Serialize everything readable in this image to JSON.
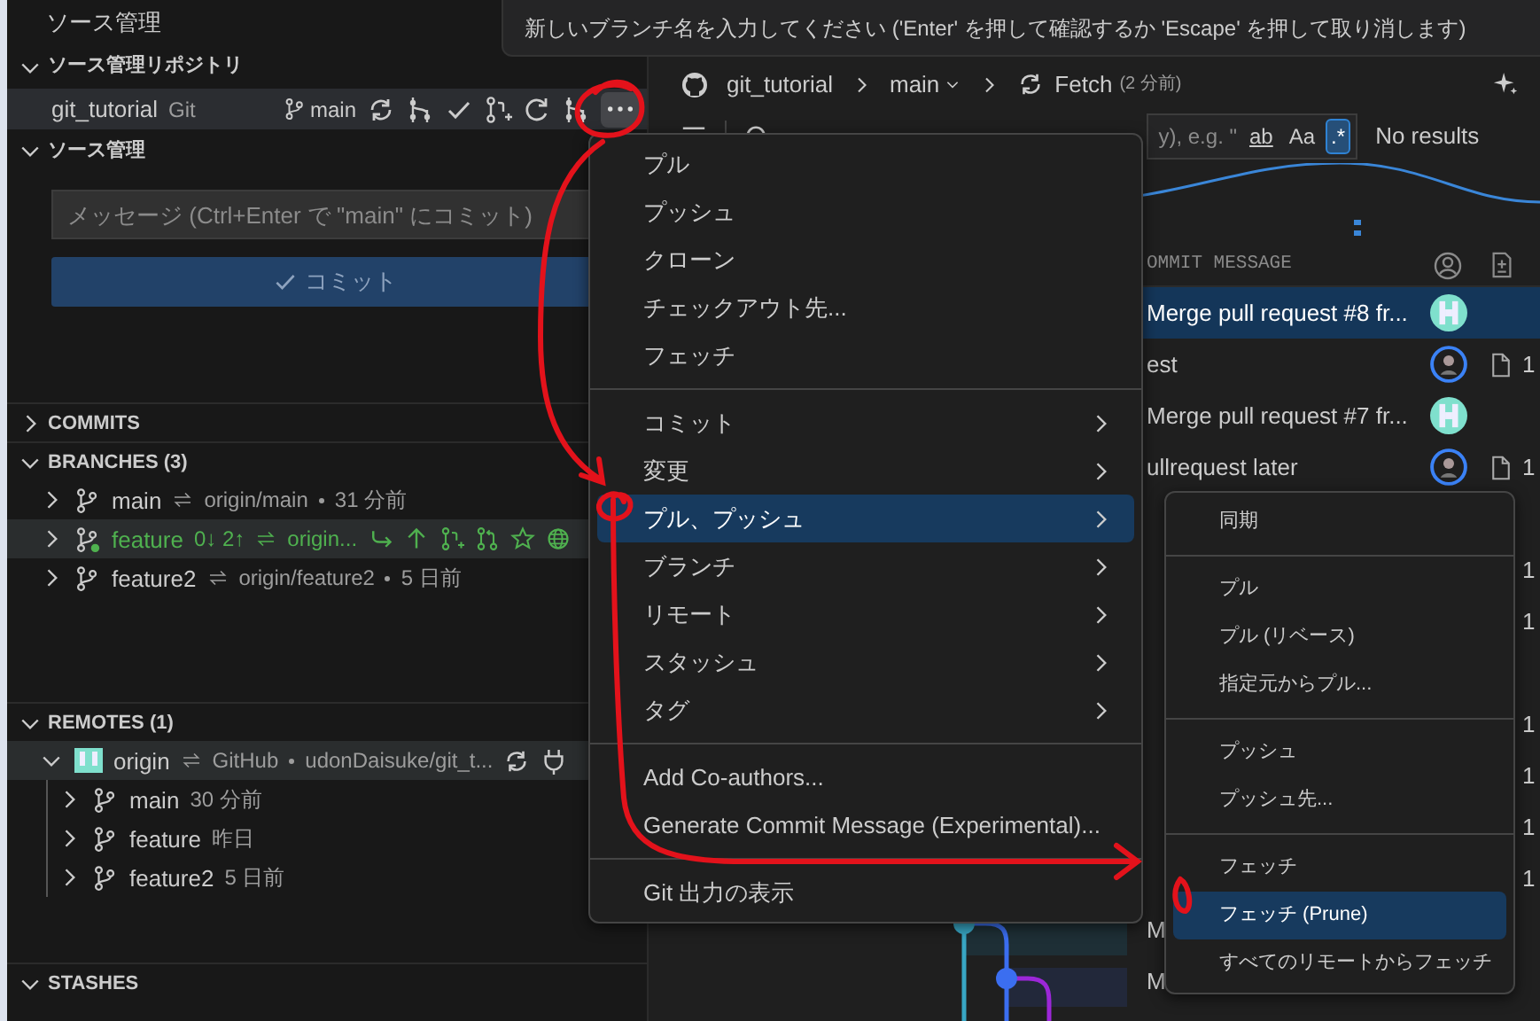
{
  "notification": {
    "text": "新しいブランチ名を入力してください ('Enter' を押して確認するか 'Escape' を押して取り消します)"
  },
  "sidebar": {
    "title": "ソース管理",
    "repositories": {
      "title": "ソース管理リポジトリ",
      "expanded": true,
      "repo": {
        "name": "git_tutorial",
        "provider": "Git",
        "branch": "main"
      }
    },
    "changes": {
      "title": "ソース管理",
      "expanded": true,
      "placeholder": "メッセージ (Ctrl+Enter で \"main\" にコミット)",
      "commit_label": "コミット"
    },
    "sections": [
      {
        "kind": "commits",
        "title": "COMMITS",
        "expanded": false
      },
      {
        "kind": "branches",
        "title": "BRANCHES (3)",
        "expanded": true,
        "items": [
          {
            "name": "main",
            "upstream": "origin/main",
            "time": "31 分前",
            "current": false,
            "selected": false,
            "expanded": false
          },
          {
            "name": "feature",
            "status": "0↓ 2↑",
            "upstream": "origin...",
            "current": true,
            "selected": true,
            "expanded": false
          },
          {
            "name": "feature2",
            "upstream": "origin/feature2",
            "time": "5 日前",
            "current": false,
            "selected": false,
            "expanded": false
          }
        ]
      },
      {
        "kind": "remotes",
        "title": "REMOTES (1)",
        "expanded": true,
        "items": [
          {
            "name": "origin",
            "provider": "GitHub",
            "path": "udonDaisuke/git_t...",
            "selected": true,
            "expanded": true,
            "children": [
              {
                "name": "main",
                "time": "30 分前",
                "expanded": false
              },
              {
                "name": "feature",
                "time": "昨日",
                "expanded": false
              },
              {
                "name": "feature2",
                "time": "5 日前",
                "expanded": false
              }
            ]
          }
        ]
      },
      {
        "kind": "stashes",
        "title": "STASHES",
        "expanded": true
      }
    ]
  },
  "graph": {
    "toolbar": {
      "repo": "git_tutorial",
      "branch": "main",
      "action": "Fetch",
      "action_time": "(2 分前)"
    },
    "search": {
      "placeholder": "y), e.g. \"",
      "toggles": [
        {
          "label": "ab",
          "selected": false
        },
        {
          "label": "Aa",
          "selected": false
        },
        {
          "label": ".*",
          "selected": true
        }
      ],
      "result": "No results"
    },
    "columns": [
      "OMMIT MESSAGE"
    ],
    "rows": [
      {
        "message": "Merge pull request #8 fr...",
        "selected": true,
        "avatar": {
          "kind": "identicon"
        }
      },
      {
        "message": "est",
        "selected": false,
        "avatar": {
          "kind": "person"
        },
        "files": "1"
      },
      {
        "message": "Merge pull request #7 fr...",
        "selected": false,
        "avatar": {
          "kind": "identicon"
        }
      },
      {
        "message": "ullrequest later",
        "selected": false,
        "avatar": {
          "kind": "person"
        },
        "files": "1"
      },
      {
        "selected": false
      },
      {
        "selected": false,
        "files": "1"
      },
      {
        "selected": false,
        "files": "1"
      },
      {
        "selected": false
      },
      {
        "selected": false,
        "files": "1"
      },
      {
        "selected": false,
        "files": "1"
      },
      {
        "selected": false,
        "files": "1"
      },
      {
        "selected": false,
        "files": "1"
      },
      {
        "message": "M",
        "selected": false
      },
      {
        "message": "M",
        "selected": false
      }
    ]
  },
  "menu": {
    "items": [
      {
        "kind": "item",
        "label": "プル"
      },
      {
        "kind": "item",
        "label": "プッシュ"
      },
      {
        "kind": "item",
        "label": "クローン"
      },
      {
        "kind": "item",
        "label": "チェックアウト先..."
      },
      {
        "kind": "item",
        "label": "フェッチ"
      },
      {
        "kind": "separator"
      },
      {
        "kind": "submenu",
        "label": "コミット",
        "selected": false
      },
      {
        "kind": "submenu",
        "label": "変更",
        "selected": false
      },
      {
        "kind": "submenu",
        "label": "プル、プッシュ",
        "selected": true
      },
      {
        "kind": "submenu",
        "label": "ブランチ",
        "selected": false
      },
      {
        "kind": "submenu",
        "label": "リモート",
        "selected": false
      },
      {
        "kind": "submenu",
        "label": "スタッシュ",
        "selected": false
      },
      {
        "kind": "submenu",
        "label": "タグ",
        "selected": false
      },
      {
        "kind": "separator"
      },
      {
        "kind": "item",
        "label": "Add Co-authors..."
      },
      {
        "kind": "item",
        "label": "Generate Commit Message (Experimental)..."
      },
      {
        "kind": "separator"
      },
      {
        "kind": "item",
        "label": "Git 出力の表示"
      }
    ]
  },
  "submenu": {
    "items": [
      {
        "kind": "item",
        "label": "同期",
        "selected": false
      },
      {
        "kind": "separator"
      },
      {
        "kind": "item",
        "label": "プル",
        "selected": false
      },
      {
        "kind": "item",
        "label": "プル (リベース)",
        "selected": false
      },
      {
        "kind": "item",
        "label": "指定元からプル...",
        "selected": false
      },
      {
        "kind": "separator"
      },
      {
        "kind": "item",
        "label": "プッシュ",
        "selected": false
      },
      {
        "kind": "item",
        "label": "プッシュ先...",
        "selected": false
      },
      {
        "kind": "separator"
      },
      {
        "kind": "item",
        "label": "フェッチ",
        "selected": false
      },
      {
        "kind": "item",
        "label": "フェッチ (Prune)",
        "selected": true
      },
      {
        "kind": "item",
        "label": "すべてのリモートからフェッチ",
        "selected": false
      }
    ]
  }
}
